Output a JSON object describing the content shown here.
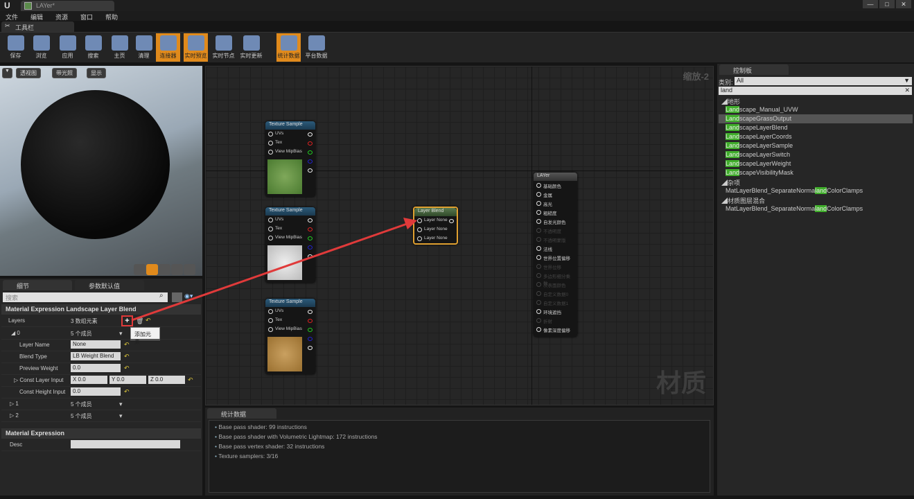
{
  "window": {
    "tab_title": "LAYer*",
    "min": "—",
    "max": "□",
    "close": "✕"
  },
  "menu": [
    "文件",
    "编辑",
    "资源",
    "窗口",
    "帮助"
  ],
  "toolbar": {
    "tab": "工具栏",
    "buttons": [
      {
        "label": "保存",
        "icon": "save-icon",
        "active": false
      },
      {
        "label": "浏览",
        "icon": "browse-icon",
        "active": false
      },
      {
        "label": "应用",
        "icon": "apply-icon",
        "active": false
      },
      {
        "label": "搜索",
        "icon": "search-icon",
        "active": false
      },
      {
        "label": "主页",
        "icon": "home-icon",
        "active": false
      },
      {
        "label": "清理",
        "icon": "clean-icon",
        "active": false
      },
      {
        "label": "连接器",
        "icon": "connector-icon",
        "active": true
      },
      {
        "label": "实时预览",
        "icon": "live-preview-icon",
        "active": true
      },
      {
        "label": "实时节点",
        "icon": "live-nodes-icon",
        "active": false
      },
      {
        "label": "实时更新",
        "icon": "live-update-icon",
        "active": false
      },
      {
        "label": "统计数据",
        "icon": "stats-icon",
        "active": true
      },
      {
        "label": "平台数据",
        "icon": "platform-stats-icon",
        "active": false
      }
    ]
  },
  "viewport": {
    "perspective": "透视图",
    "lit": "带光照",
    "show": "显示"
  },
  "details": {
    "tab_details": "细节",
    "tab_params": "参数默认值",
    "search_placeholder": "搜索",
    "section1": "Material Expression Landscape Layer Blend",
    "layers_label": "Layers",
    "layers_value": "3 数组元素",
    "add_tooltip": "添加元素",
    "item0": "0",
    "item0_value": "5 个成员",
    "layer_name_label": "Layer Name",
    "layer_name": "None",
    "blend_type_label": "Blend Type",
    "blend_type": "LB Weight Blend",
    "preview_weight_label": "Preview Weight",
    "preview_weight": "0.0",
    "const_layer_label": "Const Layer Input",
    "cx": "X  0.0",
    "cy": "Y  0.0",
    "cz": "Z  0.0",
    "const_height_label": "Const Height Input",
    "const_height": "0.0",
    "item1": "1",
    "item1_value": "5 个成员",
    "item2": "2",
    "item2_value": "5 个成员",
    "section2": "Material Expression",
    "desc_label": "Desc",
    "desc": ""
  },
  "graph": {
    "zoom": "缩放-2",
    "watermark": "材质",
    "texture_node": {
      "title": "Texture Sample",
      "pins": [
        "UVs",
        "Tex",
        "View MipBias"
      ]
    },
    "blend_node": {
      "title": "Layer Blend",
      "pins": [
        "Layer None",
        "Layer None",
        "Layer None"
      ]
    },
    "result_node": {
      "title": "LAYer",
      "pins": [
        {
          "label": "基础颜色",
          "on": true
        },
        {
          "label": "金属",
          "on": true
        },
        {
          "label": "高光",
          "on": true
        },
        {
          "label": "粗糙度",
          "on": true
        },
        {
          "label": "自发光颜色",
          "on": true
        },
        {
          "label": "不透明度",
          "on": false
        },
        {
          "label": "不透明蒙版",
          "on": false
        },
        {
          "label": "法线",
          "on": true
        },
        {
          "label": "世界位置偏移",
          "on": true
        },
        {
          "label": "世界位移",
          "on": false
        },
        {
          "label": "多边形细分乘数",
          "on": false
        },
        {
          "label": "次表面颜色",
          "on": false
        },
        {
          "label": "自定义数据0",
          "on": false
        },
        {
          "label": "自定义数据1",
          "on": false
        },
        {
          "label": "环境遮挡",
          "on": true
        },
        {
          "label": "折射",
          "on": false
        },
        {
          "label": "像素深度偏移",
          "on": true
        }
      ]
    }
  },
  "stats": {
    "tab": "统计数据",
    "lines": [
      "Base pass shader: 99 instructions",
      "Base pass shader with Volumetric Lightmap: 172 instructions",
      "Base pass vertex shader: 32 instructions",
      "Texture samplers: 3/16"
    ]
  },
  "palette": {
    "tab": "控制板",
    "category_label": "类别:",
    "category": "All",
    "search": "land",
    "groups": [
      {
        "name": "地形",
        "items": [
          [
            "Land",
            "scape_Manual_UVW",
            ""
          ],
          [
            "Land",
            "scapeGrassOutput",
            ""
          ],
          [
            "Land",
            "scapeLayerBlend",
            ""
          ],
          [
            "Land",
            "scapeLayerCoords",
            ""
          ],
          [
            "Land",
            "scapeLayerSample",
            ""
          ],
          [
            "Land",
            "scapeLayerSwitch",
            ""
          ],
          [
            "Land",
            "scapeLayerWeight",
            ""
          ],
          [
            "Land",
            "scapeVisibilityMask",
            ""
          ]
        ]
      },
      {
        "name": "杂项",
        "items": [
          [
            "MatLayerBlend_SeparateNorma",
            "land",
            "ColorClamps"
          ]
        ]
      },
      {
        "name": "材质图层混合",
        "items": [
          [
            "MatLayerBlend_SeparateNorma",
            "land",
            "ColorClamps"
          ]
        ]
      }
    ],
    "selected": "LandscapeGrassOutput"
  },
  "colors": {
    "accent": "#e08a1c",
    "highlight": "#3fae2a",
    "arrow": "#e03a3a"
  }
}
